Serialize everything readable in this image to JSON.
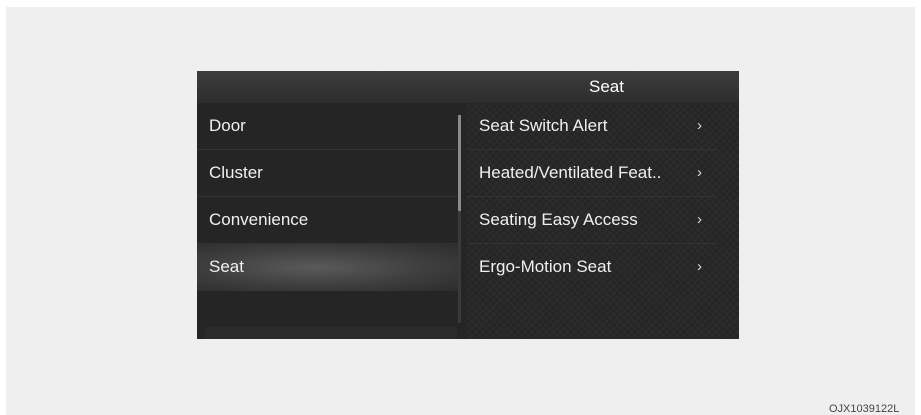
{
  "header": {
    "title": "Seat"
  },
  "left_menu": {
    "items": [
      {
        "label": "Door",
        "selected": false
      },
      {
        "label": "Cluster",
        "selected": false
      },
      {
        "label": "Convenience",
        "selected": false
      },
      {
        "label": "Seat",
        "selected": true
      }
    ]
  },
  "right_menu": {
    "items": [
      {
        "label": "Seat Switch Alert",
        "chevron": "›"
      },
      {
        "label": "Heated/Ventilated Feat..",
        "chevron": "›"
      },
      {
        "label": "Seating Easy Access",
        "chevron": "›"
      },
      {
        "label": "Ergo-Motion Seat",
        "chevron": "›"
      }
    ]
  },
  "watermark": "OJX1039122L"
}
